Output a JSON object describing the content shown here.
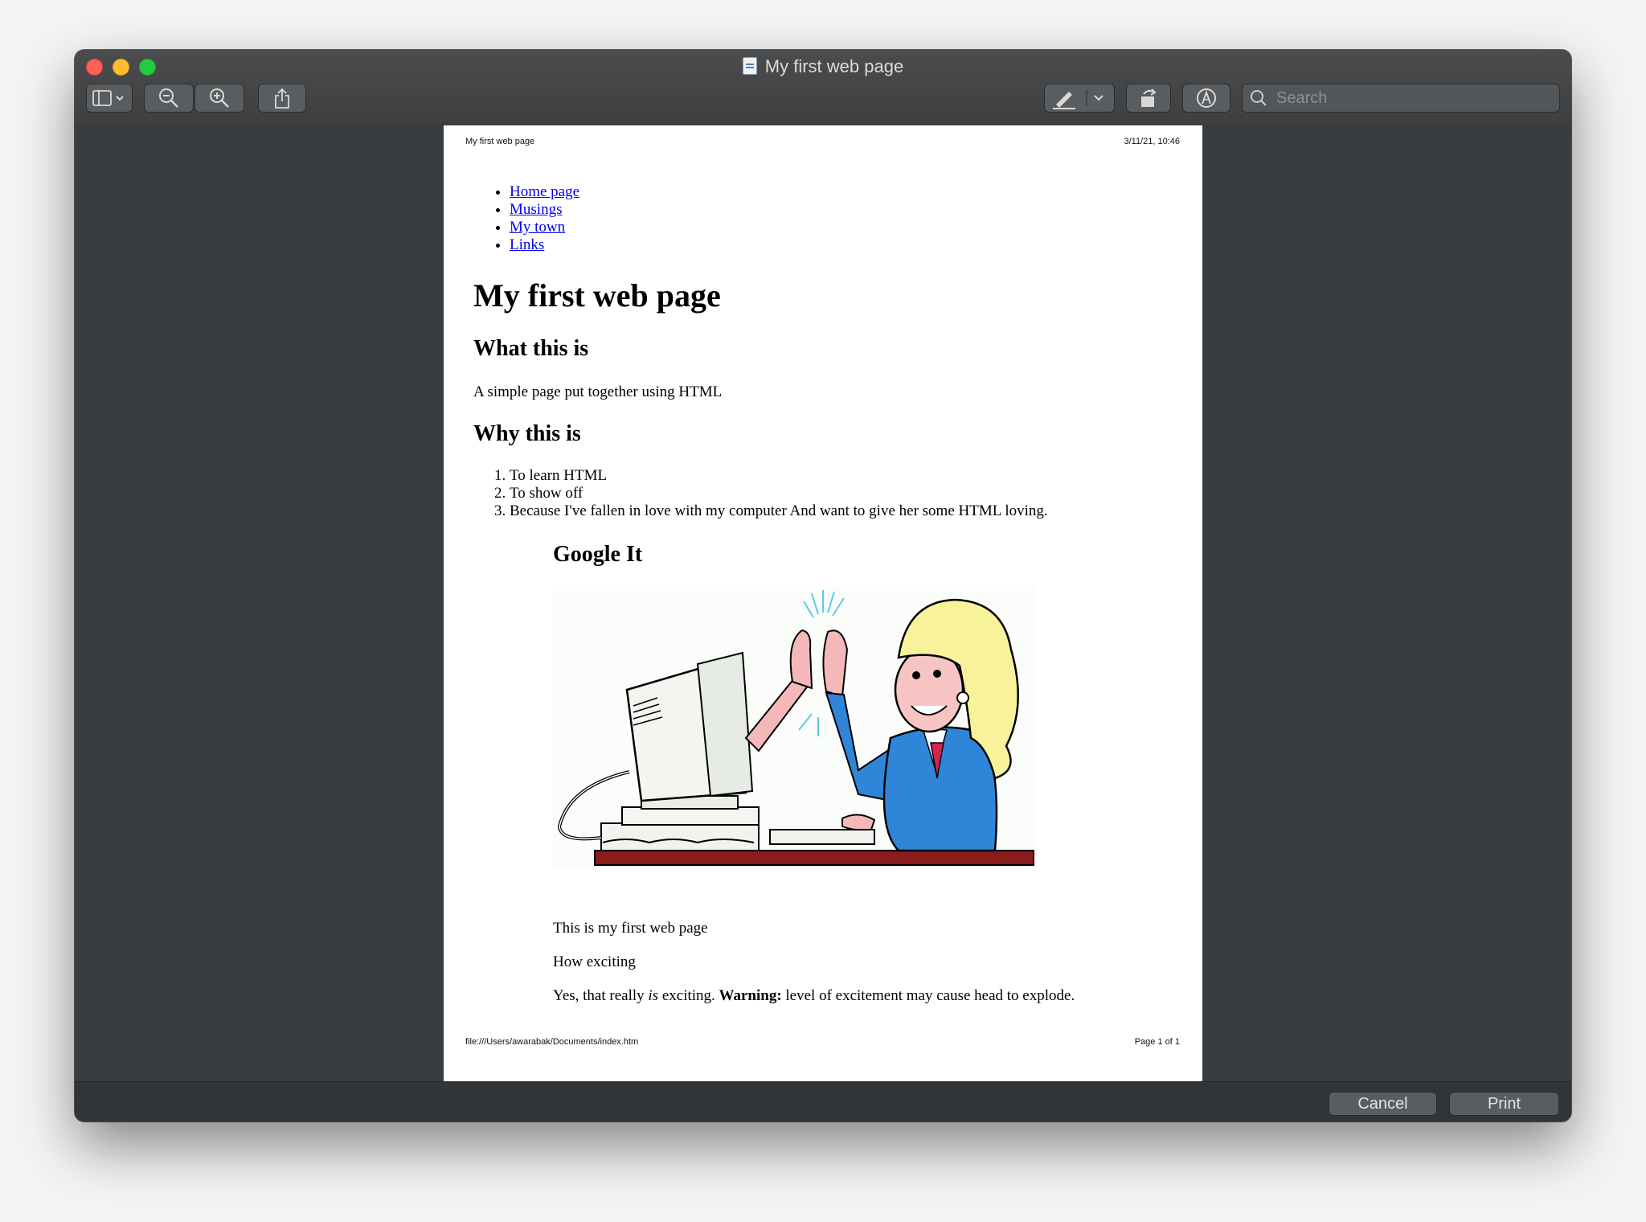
{
  "window": {
    "title": "My first web page"
  },
  "toolbar": {
    "sidebar_icon": "sidebar-icon",
    "zoom_out_icon": "zoom-out-icon",
    "zoom_in_icon": "zoom-in-icon",
    "share_icon": "share-icon",
    "highlight_icon": "highlighter-icon",
    "rotate_icon": "rotate-icon",
    "markup_icon": "markup-icon",
    "search_placeholder": "Search"
  },
  "document": {
    "header_left": "My first web page",
    "header_right": "3/11/21, 10:46",
    "nav_links": [
      "Home page",
      "Musings",
      "My town",
      "Links"
    ],
    "h1": "My first web page",
    "section1_heading": "What this is",
    "section1_text": "A simple page put together using HTML",
    "section2_heading": "Why this is",
    "reasons": [
      "To learn HTML",
      "To show off",
      "Because I've fallen in love with my computer And want to give her some HTML loving."
    ],
    "section3_heading": "Google It",
    "p1": "This is my first web page",
    "p2": "How exciting",
    "p3_start": "Yes, that really ",
    "p3_em": "is",
    "p3_mid": " exciting. ",
    "p3_strong": "Warning:",
    "p3_end": " level of excitement may cause head to explode.",
    "footer_left": "file:///Users/awarabak/Documents/index.htm",
    "footer_right": "Page 1 of 1"
  },
  "buttons": {
    "cancel": "Cancel",
    "print": "Print"
  }
}
